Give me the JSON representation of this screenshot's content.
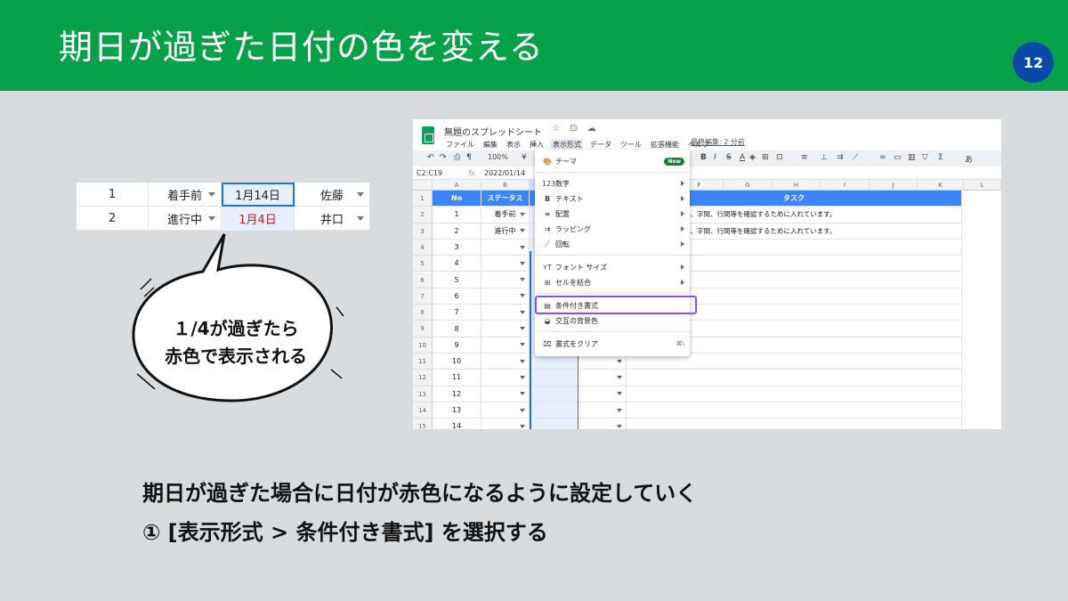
{
  "header": {
    "title": "期日が過ぎた日付の色を変える",
    "page_number": "12",
    "bg_color": "#07a14a",
    "badge_color": "#0a49a8"
  },
  "mini_table": {
    "rows": [
      {
        "no": "1",
        "status": "着手前",
        "date": "1月14日",
        "person": "佐藤",
        "date_red": false
      },
      {
        "no": "2",
        "status": "進行中",
        "date": "1月4日",
        "person": "井口",
        "date_red": true
      }
    ]
  },
  "bubble": {
    "line1": "１/4が過ぎたら",
    "line2": "赤色で表示される"
  },
  "screenshot": {
    "doc_title": "無題のスプレッドシート",
    "doc_icons": "☆ ⊡ ☁",
    "menu_bar": [
      "ファイル",
      "編集",
      "表示",
      "挿入",
      "表示形式",
      "データ",
      "ツール",
      "拡張機能",
      "ヘルプ"
    ],
    "active_menu": "表示形式",
    "last_edit": "最終編集: 2 分前",
    "toolbar": {
      "zoom": "100%",
      "currency": "¥",
      "text_symbol": "あ"
    },
    "name_box": "C2:C19",
    "fx": "fx",
    "formula_value": "2022/01/14",
    "col_headers": [
      "A",
      "B",
      "",
      "",
      "",
      "F",
      "G",
      "H",
      "I",
      "J",
      "K",
      "L"
    ],
    "table_headers": {
      "no": "No",
      "status": "ステータス",
      "task": "タスク"
    },
    "rows": [
      {
        "r": "1",
        "no": "",
        "status": ""
      },
      {
        "r": "2",
        "no": "1",
        "status": "着手前",
        "task": "。文字の大きさ、量、字間、行間等を確認するために入れています。"
      },
      {
        "r": "3",
        "no": "2",
        "status": "進行中",
        "task": "。文字の大きさ、量、字間、行間等を確認するために入れています。"
      },
      {
        "r": "4",
        "no": "3"
      },
      {
        "r": "5",
        "no": "4"
      },
      {
        "r": "6",
        "no": "5"
      },
      {
        "r": "7",
        "no": "6"
      },
      {
        "r": "8",
        "no": "7"
      },
      {
        "r": "9",
        "no": "8"
      },
      {
        "r": "10",
        "no": "9"
      },
      {
        "r": "11",
        "no": "10"
      },
      {
        "r": "12",
        "no": "11"
      },
      {
        "r": "13",
        "no": "12"
      },
      {
        "r": "14",
        "no": "13"
      },
      {
        "r": "15",
        "no": "14"
      }
    ],
    "format_menu": {
      "items": [
        {
          "icon": "palette-icon",
          "glyph": "🎨",
          "label": "テーマ",
          "badge": "New"
        },
        {
          "icon": "number-icon",
          "glyph": "123",
          "label": "数字",
          "submenu": true
        },
        {
          "icon": "bold-icon",
          "glyph": "B",
          "label": "テキスト",
          "submenu": true
        },
        {
          "icon": "align-icon",
          "glyph": "≡",
          "label": "配置",
          "submenu": true
        },
        {
          "icon": "wrap-icon",
          "glyph": "⇉",
          "label": "ラッピング",
          "submenu": true
        },
        {
          "icon": "rotate-icon",
          "glyph": "⟋",
          "label": "回転",
          "submenu": true
        },
        {
          "icon": "font-size-icon",
          "glyph": "тT",
          "label": "フォント サイズ",
          "submenu": true
        },
        {
          "icon": "merge-icon",
          "glyph": "⊞",
          "label": "セルを結合",
          "submenu": true
        },
        {
          "icon": "conditional-format-icon",
          "glyph": "▤",
          "label": "条件付き書式"
        },
        {
          "icon": "alternating-colors-icon",
          "glyph": "◒",
          "label": "交互の背景色"
        },
        {
          "icon": "clear-format-icon",
          "glyph": "⌧",
          "label": "書式をクリア",
          "shortcut": "⌘\\"
        }
      ]
    }
  },
  "caption": {
    "line1": "期日が過ぎた場合に日付が赤色になるように設定していく",
    "line2": "① [表示形式 > 条件付き書式] を選択する"
  }
}
